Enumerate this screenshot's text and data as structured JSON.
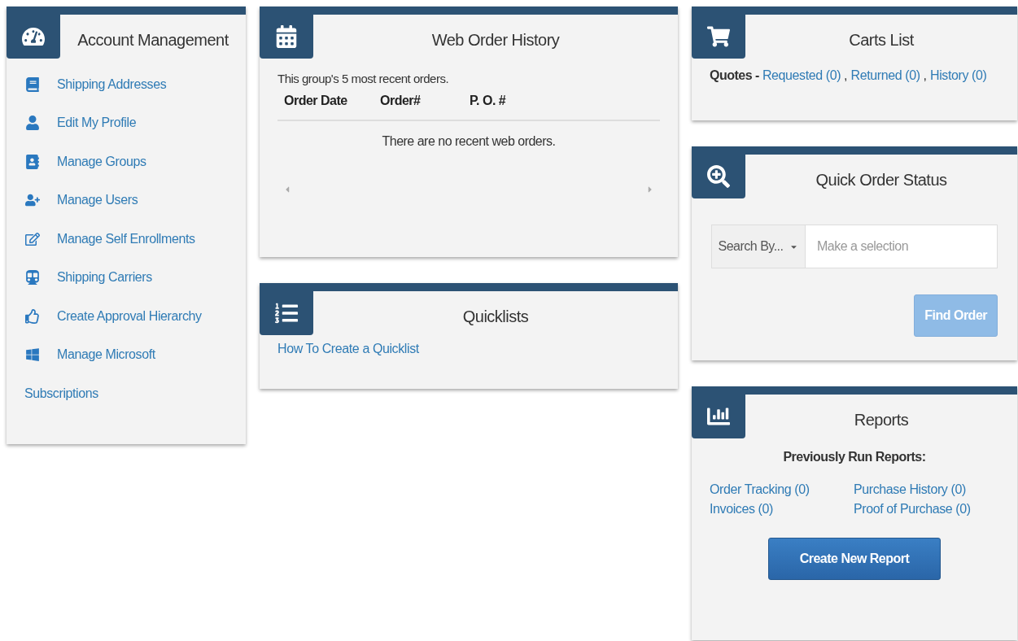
{
  "account_management": {
    "title": "Account Management",
    "links": [
      "Shipping Addresses",
      "Edit My Profile",
      "Manage Groups",
      "Manage Users",
      "Manage Self Enrollments",
      "Shipping Carriers",
      "Create Approval Hierarchy",
      "Manage Microsoft"
    ],
    "footer_link": "Subscriptions"
  },
  "web_order_history": {
    "title": "Web Order History",
    "note": "This group's 5 most recent orders.",
    "table": {
      "columns": [
        "Order Date",
        "Order#",
        "P. O. #"
      ],
      "empty_message": "There are no recent web orders."
    }
  },
  "quicklists": {
    "title": "Quicklists",
    "links": [
      "How To Create a Quicklist"
    ]
  },
  "carts_list": {
    "title": "Carts List",
    "label": "Quotes -",
    "links": [
      {
        "label": "Requested (0)",
        "separator": ","
      },
      {
        "label": "Returned (0)",
        "separator": ","
      },
      {
        "label": "History (0)"
      }
    ]
  },
  "quick_order_status": {
    "title": "Quick Order Status",
    "search_by": "Search By...",
    "placeholder": "Make a selection",
    "button": {
      "label": "Find Order",
      "disabled": true
    }
  },
  "reports": {
    "title": "Reports",
    "subtitle": "Previously Run Reports:",
    "links": [
      "Order Tracking (0)",
      "Purchase History (0)",
      "Invoices (0)",
      "Proof of Purchase (0)"
    ],
    "button": "Create New Report"
  }
}
